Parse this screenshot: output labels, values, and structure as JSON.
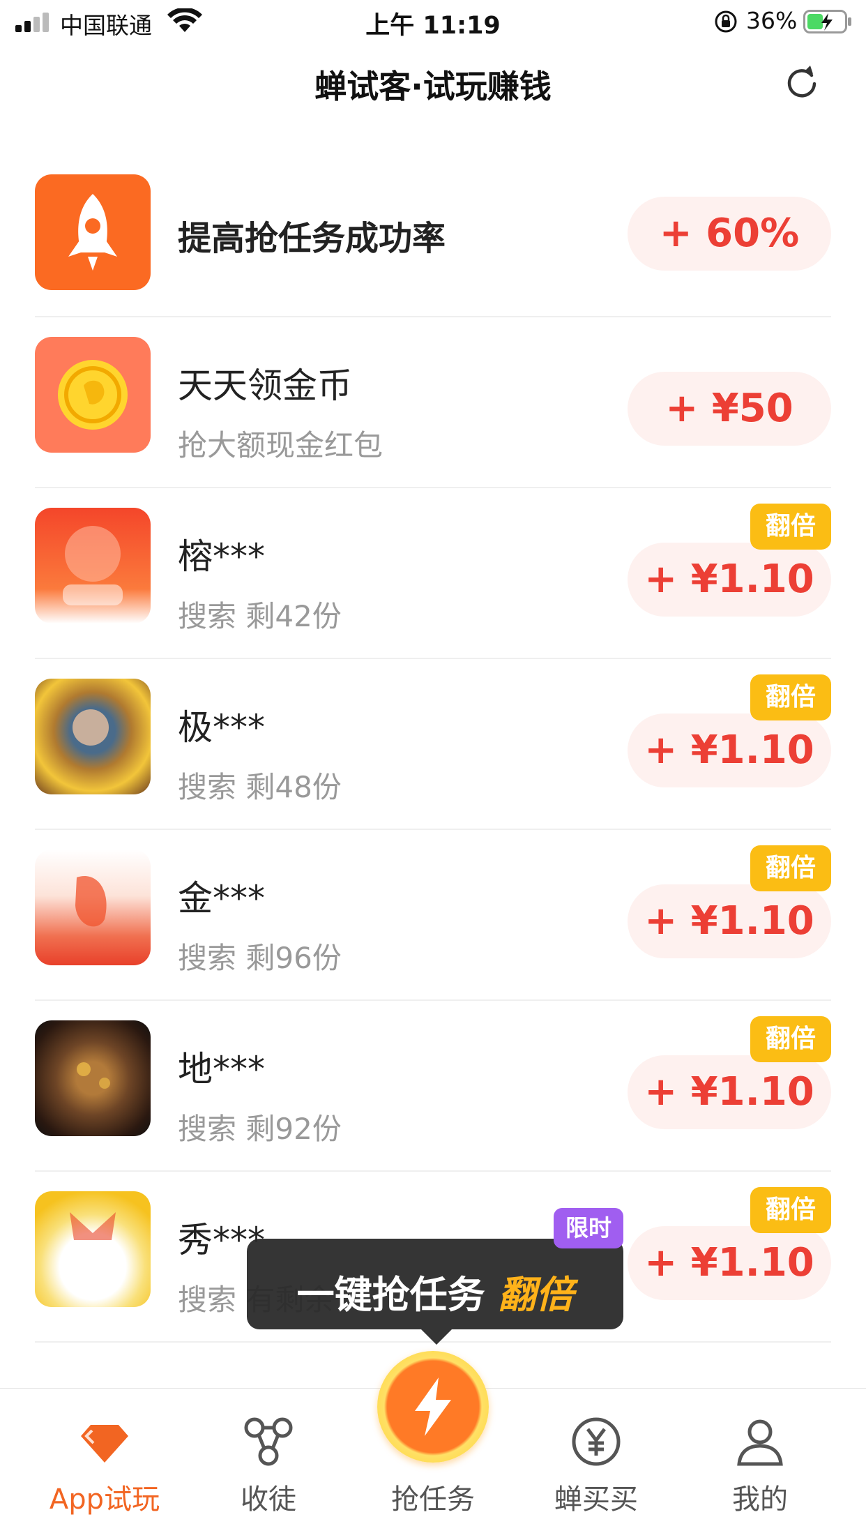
{
  "status_bar": {
    "carrier": "中国联通",
    "time": "上午 11:19",
    "battery": "36%"
  },
  "nav": {
    "title": "蝉试客·试玩赚钱"
  },
  "tasks": [
    {
      "name": "提高抢任务成功率",
      "sub": "",
      "reward": "+ 60%",
      "badge": "",
      "icon": "rocket-icon",
      "color": "#fb6a22"
    },
    {
      "name": "天天领金币",
      "sub": "抢大额现金红包",
      "reward": "+ ¥50",
      "badge": "",
      "icon": "coin-icon",
      "color": "#ff7b5a"
    },
    {
      "name": "榕***",
      "sub": "搜索 剩42份",
      "reward": "+ ¥1.10",
      "badge": "翻倍",
      "icon": "app-thumbnail-icon",
      "color": "#f4462a"
    },
    {
      "name": "极***",
      "sub": "搜索 剩48份",
      "reward": "+ ¥1.10",
      "badge": "翻倍",
      "icon": "app-thumbnail-icon",
      "color": "#7a4a2a"
    },
    {
      "name": "金***",
      "sub": "搜索 剩96份",
      "reward": "+ ¥1.10",
      "badge": "翻倍",
      "icon": "app-thumbnail-icon",
      "color": "#f0532c"
    },
    {
      "name": "地***",
      "sub": "搜索 剩92份",
      "reward": "+ ¥1.10",
      "badge": "翻倍",
      "icon": "app-thumbnail-icon",
      "color": "#3a2418"
    },
    {
      "name": "秀***",
      "sub": "搜索 有剩余",
      "reward": "+ ¥1.10",
      "badge": "翻倍",
      "icon": "app-thumbnail-icon",
      "color": "#f6c21f"
    }
  ],
  "popup": {
    "text": "一键抢任务",
    "highlight": "翻倍",
    "tag": "限时"
  },
  "tab_bar": {
    "tabs": [
      {
        "label": "App试玩",
        "icon": "diamond-icon",
        "active": true
      },
      {
        "label": "收徒",
        "icon": "share-nodes-icon",
        "active": false
      },
      {
        "label": "抢任务",
        "icon": "lightning-icon",
        "active": false
      },
      {
        "label": "蝉买买",
        "icon": "yen-circle-icon",
        "active": false
      },
      {
        "label": "我的",
        "icon": "person-icon",
        "active": false
      }
    ]
  },
  "colors": {
    "accent": "#f26522",
    "reward_text": "#ec3f35",
    "reward_bg": "#fef1ef",
    "badge": "#fbbd14",
    "limited_tag": "#a05ef0"
  }
}
